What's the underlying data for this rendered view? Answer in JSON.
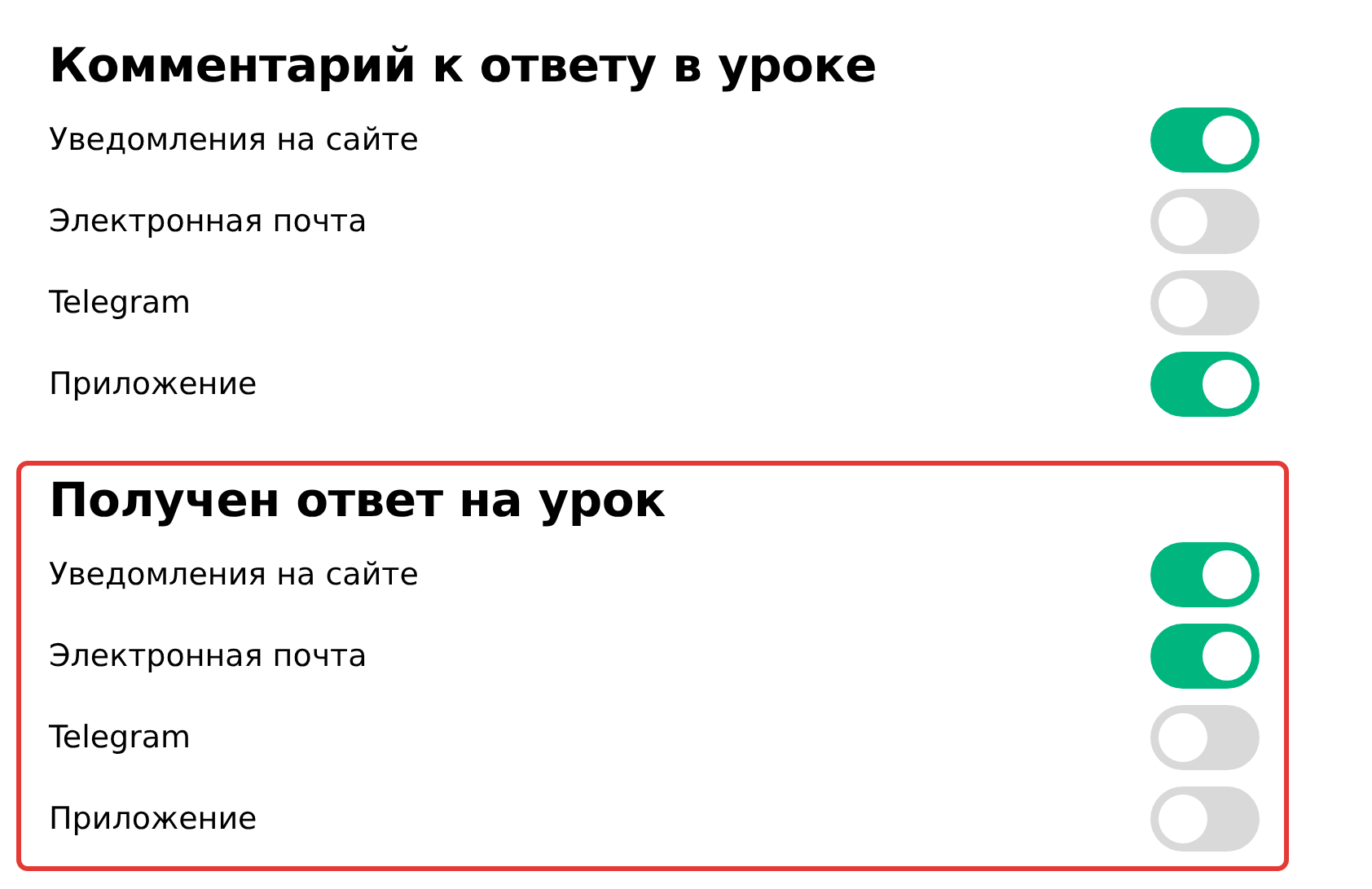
{
  "sections": [
    {
      "title": "Комментарий к ответу в уроке",
      "highlighted": false,
      "items": [
        {
          "label": "Уведомления на сайте",
          "on": true
        },
        {
          "label": "Электронная почта",
          "on": false
        },
        {
          "label": "Telegram",
          "on": false
        },
        {
          "label": "Приложение",
          "on": true
        }
      ]
    },
    {
      "title": "Получен ответ на урок",
      "highlighted": true,
      "items": [
        {
          "label": "Уведомления на сайте",
          "on": true
        },
        {
          "label": "Электронная почта",
          "on": true
        },
        {
          "label": "Telegram",
          "on": false
        },
        {
          "label": "Приложение",
          "on": false
        }
      ]
    }
  ]
}
